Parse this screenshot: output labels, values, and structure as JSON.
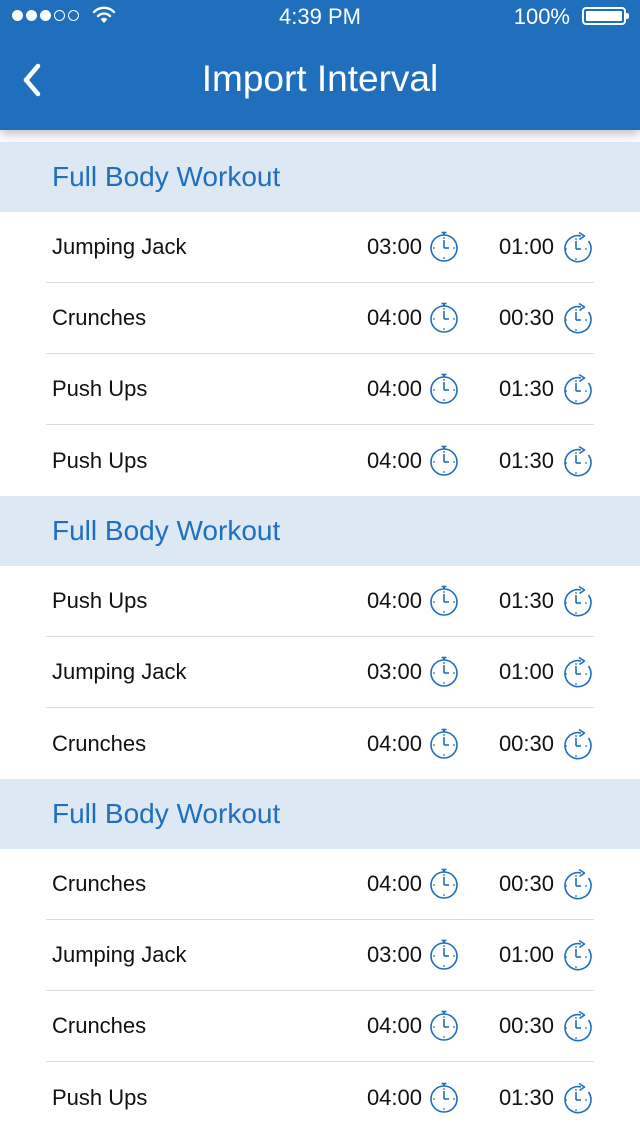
{
  "status_bar": {
    "time": "4:39 PM",
    "battery": "100%"
  },
  "nav": {
    "title": "Import Interval"
  },
  "sections": [
    {
      "title": "Full Body Workout",
      "items": [
        {
          "name": "Jumping Jack",
          "work": "03:00",
          "rest": "01:00"
        },
        {
          "name": "Crunches",
          "work": "04:00",
          "rest": "00:30"
        },
        {
          "name": "Push Ups",
          "work": "04:00",
          "rest": "01:30"
        },
        {
          "name": "Push Ups",
          "work": "04:00",
          "rest": "01:30"
        }
      ]
    },
    {
      "title": "Full Body Workout",
      "items": [
        {
          "name": "Push Ups",
          "work": "04:00",
          "rest": "01:30"
        },
        {
          "name": "Jumping Jack",
          "work": "03:00",
          "rest": "01:00"
        },
        {
          "name": "Crunches",
          "work": "04:00",
          "rest": "00:30"
        }
      ]
    },
    {
      "title": "Full Body Workout",
      "items": [
        {
          "name": "Crunches",
          "work": "04:00",
          "rest": "00:30"
        },
        {
          "name": "Jumping Jack",
          "work": "03:00",
          "rest": "01:00"
        },
        {
          "name": "Crunches",
          "work": "04:00",
          "rest": "00:30"
        },
        {
          "name": "Push Ups",
          "work": "04:00",
          "rest": "01:30"
        }
      ]
    }
  ],
  "colors": {
    "primary": "#1f6fbd",
    "section_bg": "#dce8f4"
  },
  "icons": {
    "work": "stopwatch-icon",
    "rest": "rest-timer-icon"
  }
}
